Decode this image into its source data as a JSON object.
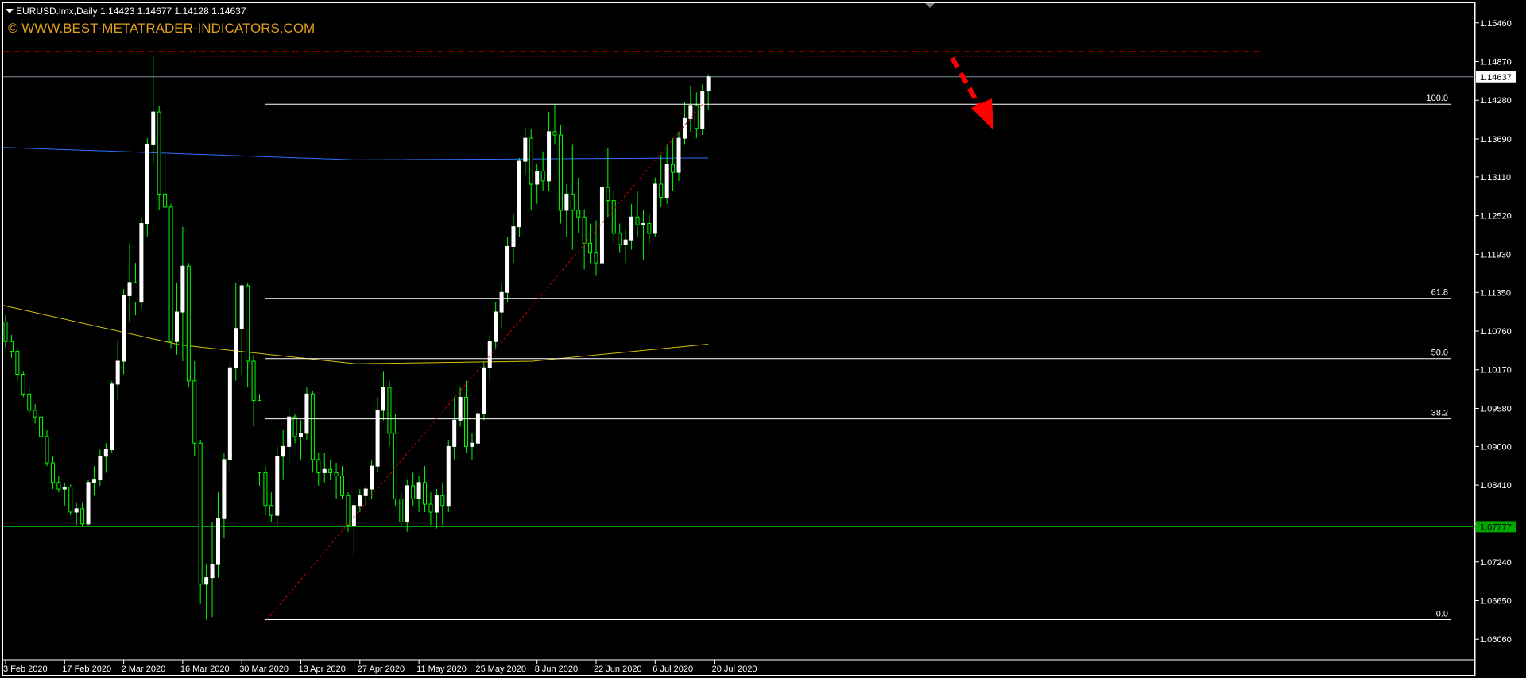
{
  "header": {
    "symbol_line": "EURUSD.lmx,Daily  1.14423 1.14677 1.14128 1.14637",
    "watermark": "© WWW.BEST-METATRADER-INDICATORS.COM"
  },
  "price_scale": {
    "ticks": [
      "1.15460",
      "1.14870",
      "1.14280",
      "1.13690",
      "1.13110",
      "1.12520",
      "1.11930",
      "1.11350",
      "1.10760",
      "1.10170",
      "1.09580",
      "1.09000",
      "1.08410",
      "1.07820",
      "1.07240",
      "1.06650",
      "1.06060"
    ],
    "current_price_label": "1.14637",
    "support_label": "1.07777"
  },
  "time_scale": {
    "ticks": [
      "3 Feb 2020",
      "17 Feb 2020",
      "2 Mar 2020",
      "16 Mar 2020",
      "30 Mar 2020",
      "13 Apr 2020",
      "27 Apr 2020",
      "11 May 2020",
      "25 May 2020",
      "8 Jun 2020",
      "22 Jun 2020",
      "6 Jul 2020",
      "20 Jul 2020"
    ]
  },
  "fibonacci": {
    "levels": [
      {
        "label": "100.0",
        "price": 1.1422
      },
      {
        "label": "61.8",
        "price": 1.1126
      },
      {
        "label": "50.0",
        "price": 1.1034
      },
      {
        "label": "38.2",
        "price": 1.0942
      },
      {
        "label": "0.0",
        "price": 1.0636
      }
    ]
  },
  "colors": {
    "background": "#000000",
    "bull_candle": "#ffffff",
    "bear_candle": "#00ff00",
    "wick": "#00ff00",
    "ma_blue": "#2f6fff",
    "ma_yellow": "#d4c20a",
    "fib_line": "#ffffff",
    "resistance_red": "#cc0000",
    "support_green": "#00aa00",
    "arrow_red": "#ff0000",
    "watermark": "#e0a020"
  },
  "chart_data": {
    "type": "candlestick",
    "symbol": "EURUSD.lmx",
    "timeframe": "Daily",
    "last_bar": {
      "open": 1.14423,
      "high": 1.14677,
      "low": 1.14128,
      "close": 1.14637
    },
    "ylim": [
      1.0576,
      1.1576
    ],
    "x": [
      "3 Feb 2020",
      "4 Feb 2020",
      "5 Feb 2020",
      "6 Feb 2020",
      "7 Feb 2020",
      "10 Feb 2020",
      "11 Feb 2020",
      "12 Feb 2020",
      "13 Feb 2020",
      "14 Feb 2020",
      "17 Feb 2020",
      "18 Feb 2020",
      "19 Feb 2020",
      "20 Feb 2020",
      "21 Feb 2020",
      "24 Feb 2020",
      "25 Feb 2020",
      "26 Feb 2020",
      "27 Feb 2020",
      "28 Feb 2020",
      "2 Mar 2020",
      "3 Mar 2020",
      "4 Mar 2020",
      "5 Mar 2020",
      "6 Mar 2020",
      "9 Mar 2020",
      "10 Mar 2020",
      "11 Mar 2020",
      "12 Mar 2020",
      "13 Mar 2020",
      "16 Mar 2020",
      "17 Mar 2020",
      "18 Mar 2020",
      "19 Mar 2020",
      "20 Mar 2020",
      "23 Mar 2020",
      "24 Mar 2020",
      "25 Mar 2020",
      "26 Mar 2020",
      "27 Mar 2020",
      "30 Mar 2020",
      "31 Mar 2020",
      "1 Apr 2020",
      "2 Apr 2020",
      "3 Apr 2020",
      "6 Apr 2020",
      "7 Apr 2020",
      "8 Apr 2020",
      "9 Apr 2020",
      "10 Apr 2020",
      "13 Apr 2020",
      "14 Apr 2020",
      "15 Apr 2020",
      "16 Apr 2020",
      "17 Apr 2020",
      "20 Apr 2020",
      "21 Apr 2020",
      "22 Apr 2020",
      "23 Apr 2020",
      "24 Apr 2020",
      "27 Apr 2020",
      "28 Apr 2020",
      "29 Apr 2020",
      "30 Apr 2020",
      "1 May 2020",
      "4 May 2020",
      "5 May 2020",
      "6 May 2020",
      "7 May 2020",
      "8 May 2020",
      "11 May 2020",
      "12 May 2020",
      "13 May 2020",
      "14 May 2020",
      "15 May 2020",
      "18 May 2020",
      "19 May 2020",
      "20 May 2020",
      "21 May 2020",
      "22 May 2020",
      "25 May 2020",
      "26 May 2020",
      "27 May 2020",
      "28 May 2020",
      "29 May 2020",
      "1 Jun 2020",
      "2 Jun 2020",
      "3 Jun 2020",
      "4 Jun 2020",
      "5 Jun 2020",
      "8 Jun 2020",
      "9 Jun 2020",
      "10 Jun 2020",
      "11 Jun 2020",
      "12 Jun 2020",
      "15 Jun 2020",
      "16 Jun 2020",
      "17 Jun 2020",
      "18 Jun 2020",
      "19 Jun 2020",
      "22 Jun 2020",
      "23 Jun 2020",
      "24 Jun 2020",
      "25 Jun 2020",
      "26 Jun 2020",
      "29 Jun 2020",
      "30 Jun 2020",
      "1 Jul 2020",
      "2 Jul 2020",
      "3 Jul 2020",
      "6 Jul 2020",
      "7 Jul 2020",
      "8 Jul 2020",
      "9 Jul 2020",
      "10 Jul 2020",
      "13 Jul 2020",
      "14 Jul 2020",
      "15 Jul 2020",
      "16 Jul 2020",
      "17 Jul 2020",
      "20 Jul 2020"
    ],
    "ohlc": [
      [
        1.109,
        1.11,
        1.105,
        1.106
      ],
      [
        1.106,
        1.107,
        1.1035,
        1.1045
      ],
      [
        1.1045,
        1.105,
        1.1,
        1.101
      ],
      [
        1.101,
        1.1015,
        1.0975,
        1.098
      ],
      [
        1.098,
        1.099,
        1.095,
        1.0955
      ],
      [
        1.0955,
        1.0965,
        1.0935,
        1.0945
      ],
      [
        1.0945,
        1.0955,
        1.0905,
        1.0915
      ],
      [
        1.0915,
        1.0925,
        1.087,
        1.0875
      ],
      [
        1.0875,
        1.0885,
        1.0835,
        1.0845
      ],
      [
        1.0845,
        1.0855,
        1.083,
        1.0835
      ],
      [
        1.0835,
        1.0845,
        1.081,
        1.0838
      ],
      [
        1.0838,
        1.0842,
        1.0795,
        1.08
      ],
      [
        1.08,
        1.0815,
        1.078,
        1.0805
      ],
      [
        1.0805,
        1.0815,
        1.0778,
        1.0782
      ],
      [
        1.0782,
        1.085,
        1.078,
        1.0845
      ],
      [
        1.0845,
        1.087,
        1.0825,
        1.085
      ],
      [
        1.085,
        1.0895,
        1.084,
        1.0885
      ],
      [
        1.0885,
        1.0905,
        1.086,
        1.0895
      ],
      [
        1.0895,
        1.1,
        1.089,
        1.0995
      ],
      [
        1.0995,
        1.106,
        1.097,
        1.103
      ],
      [
        1.103,
        1.114,
        1.101,
        1.113
      ],
      [
        1.113,
        1.121,
        1.109,
        1.115
      ],
      [
        1.115,
        1.118,
        1.11,
        1.112
      ],
      [
        1.112,
        1.125,
        1.111,
        1.124
      ],
      [
        1.124,
        1.137,
        1.122,
        1.136
      ],
      [
        1.136,
        1.1495,
        1.133,
        1.141
      ],
      [
        1.141,
        1.142,
        1.126,
        1.1285
      ],
      [
        1.1285,
        1.1345,
        1.126,
        1.1265
      ],
      [
        1.1265,
        1.127,
        1.105,
        1.106
      ],
      [
        1.106,
        1.115,
        1.104,
        1.1105
      ],
      [
        1.1105,
        1.1235,
        1.103,
        1.1175
      ],
      [
        1.1175,
        1.118,
        1.099,
        1.1
      ],
      [
        1.1,
        1.103,
        1.0885,
        1.0905
      ],
      [
        1.0905,
        1.091,
        1.066,
        1.069
      ],
      [
        1.069,
        1.072,
        1.0636,
        1.07
      ],
      [
        1.07,
        1.0785,
        1.064,
        1.072
      ],
      [
        1.072,
        1.083,
        1.07,
        1.079
      ],
      [
        1.079,
        1.089,
        1.076,
        1.088
      ],
      [
        1.088,
        1.103,
        1.086,
        1.102
      ],
      [
        1.102,
        1.115,
        1.1,
        1.108
      ],
      [
        1.108,
        1.115,
        1.101,
        1.1145
      ],
      [
        1.1145,
        1.115,
        1.099,
        1.103
      ],
      [
        1.103,
        1.104,
        1.093,
        1.097
      ],
      [
        1.097,
        1.098,
        1.084,
        1.086
      ],
      [
        1.086,
        1.087,
        1.0795,
        1.081
      ],
      [
        1.081,
        1.083,
        1.0785,
        1.0795
      ],
      [
        1.0795,
        1.09,
        1.078,
        1.0885
      ],
      [
        1.0885,
        1.0925,
        1.085,
        1.09
      ],
      [
        1.09,
        1.096,
        1.0875,
        1.0945
      ],
      [
        1.0945,
        1.095,
        1.0905,
        1.0915
      ],
      [
        1.0915,
        1.094,
        1.088,
        1.092
      ],
      [
        1.092,
        1.099,
        1.091,
        1.098
      ],
      [
        1.098,
        1.0985,
        1.086,
        1.088
      ],
      [
        1.088,
        1.089,
        1.084,
        1.086
      ],
      [
        1.086,
        1.089,
        1.0845,
        1.0865
      ],
      [
        1.0865,
        1.088,
        1.085,
        1.086
      ],
      [
        1.086,
        1.0875,
        1.082,
        1.0855
      ],
      [
        1.0855,
        1.087,
        1.082,
        1.0825
      ],
      [
        1.0825,
        1.083,
        1.077,
        1.078
      ],
      [
        1.078,
        1.082,
        1.073,
        1.081
      ],
      [
        1.081,
        1.0835,
        1.08,
        1.0825
      ],
      [
        1.0825,
        1.084,
        1.081,
        1.0835
      ],
      [
        1.0835,
        1.088,
        1.082,
        1.087
      ],
      [
        1.087,
        1.0975,
        1.086,
        1.0955
      ],
      [
        1.0955,
        1.1015,
        1.094,
        1.099
      ],
      [
        1.099,
        1.1,
        1.09,
        1.092
      ],
      [
        1.092,
        1.095,
        1.081,
        1.082
      ],
      [
        1.082,
        1.083,
        1.078,
        1.0785
      ],
      [
        1.0785,
        1.085,
        1.077,
        1.084
      ],
      [
        1.084,
        1.086,
        1.081,
        1.082
      ],
      [
        1.082,
        1.0855,
        1.08,
        1.0845
      ],
      [
        1.0845,
        1.087,
        1.08,
        1.0812
      ],
      [
        1.0812,
        1.083,
        1.078,
        1.08
      ],
      [
        1.08,
        1.0835,
        1.0775,
        1.0825
      ],
      [
        1.0825,
        1.0845,
        1.078,
        1.081
      ],
      [
        1.081,
        1.091,
        1.08,
        1.09
      ],
      [
        1.09,
        1.0975,
        1.088,
        1.094
      ],
      [
        1.094,
        1.099,
        1.093,
        1.0975
      ],
      [
        1.0975,
        1.1,
        1.089,
        1.09
      ],
      [
        1.09,
        1.092,
        1.088,
        1.0905
      ],
      [
        1.0905,
        1.096,
        1.09,
        1.095
      ],
      [
        1.095,
        1.103,
        1.094,
        1.102
      ],
      [
        1.102,
        1.107,
        1.1,
        1.106
      ],
      [
        1.106,
        1.112,
        1.105,
        1.1105
      ],
      [
        1.1105,
        1.115,
        1.108,
        1.1135
      ],
      [
        1.1135,
        1.122,
        1.112,
        1.1205
      ],
      [
        1.1205,
        1.1255,
        1.118,
        1.1235
      ],
      [
        1.1235,
        1.134,
        1.122,
        1.1335
      ],
      [
        1.1335,
        1.1385,
        1.1315,
        1.137
      ],
      [
        1.137,
        1.1384,
        1.126,
        1.13
      ],
      [
        1.13,
        1.133,
        1.127,
        1.132
      ],
      [
        1.132,
        1.135,
        1.129,
        1.1305
      ],
      [
        1.1305,
        1.141,
        1.129,
        1.138
      ],
      [
        1.138,
        1.1422,
        1.136,
        1.1375
      ],
      [
        1.1375,
        1.139,
        1.124,
        1.126
      ],
      [
        1.126,
        1.13,
        1.122,
        1.1285
      ],
      [
        1.1285,
        1.136,
        1.12,
        1.126
      ],
      [
        1.126,
        1.131,
        1.1225,
        1.125
      ],
      [
        1.125,
        1.1262,
        1.117,
        1.121
      ],
      [
        1.121,
        1.124,
        1.118,
        1.1195
      ],
      [
        1.1195,
        1.1245,
        1.116,
        1.118
      ],
      [
        1.118,
        1.13,
        1.1168,
        1.1295
      ],
      [
        1.1295,
        1.1355,
        1.125,
        1.1275
      ],
      [
        1.1275,
        1.129,
        1.121,
        1.1225
      ],
      [
        1.1225,
        1.124,
        1.1195,
        1.1208
      ],
      [
        1.1208,
        1.123,
        1.118,
        1.1215
      ],
      [
        1.1215,
        1.127,
        1.12,
        1.125
      ],
      [
        1.125,
        1.129,
        1.122,
        1.1238
      ],
      [
        1.1238,
        1.126,
        1.1185,
        1.124
      ],
      [
        1.124,
        1.1255,
        1.121,
        1.1225
      ],
      [
        1.1225,
        1.131,
        1.122,
        1.13
      ],
      [
        1.13,
        1.1345,
        1.1265,
        1.128
      ],
      [
        1.128,
        1.136,
        1.127,
        1.133
      ],
      [
        1.133,
        1.137,
        1.129,
        1.1318
      ],
      [
        1.1318,
        1.138,
        1.1305,
        1.137
      ],
      [
        1.137,
        1.1425,
        1.136,
        1.14
      ],
      [
        1.14,
        1.145,
        1.138,
        1.142
      ],
      [
        1.142,
        1.144,
        1.137,
        1.1385
      ],
      [
        1.1385,
        1.1452,
        1.1375,
        1.1442
      ],
      [
        1.14423,
        1.14677,
        1.14128,
        1.14637
      ]
    ],
    "ma_blue": [
      1.1356,
      1.1337,
      1.134
    ],
    "ma_yellow": [
      1.1115,
      1.1055,
      1.1026,
      1.103,
      1.1056
    ]
  }
}
